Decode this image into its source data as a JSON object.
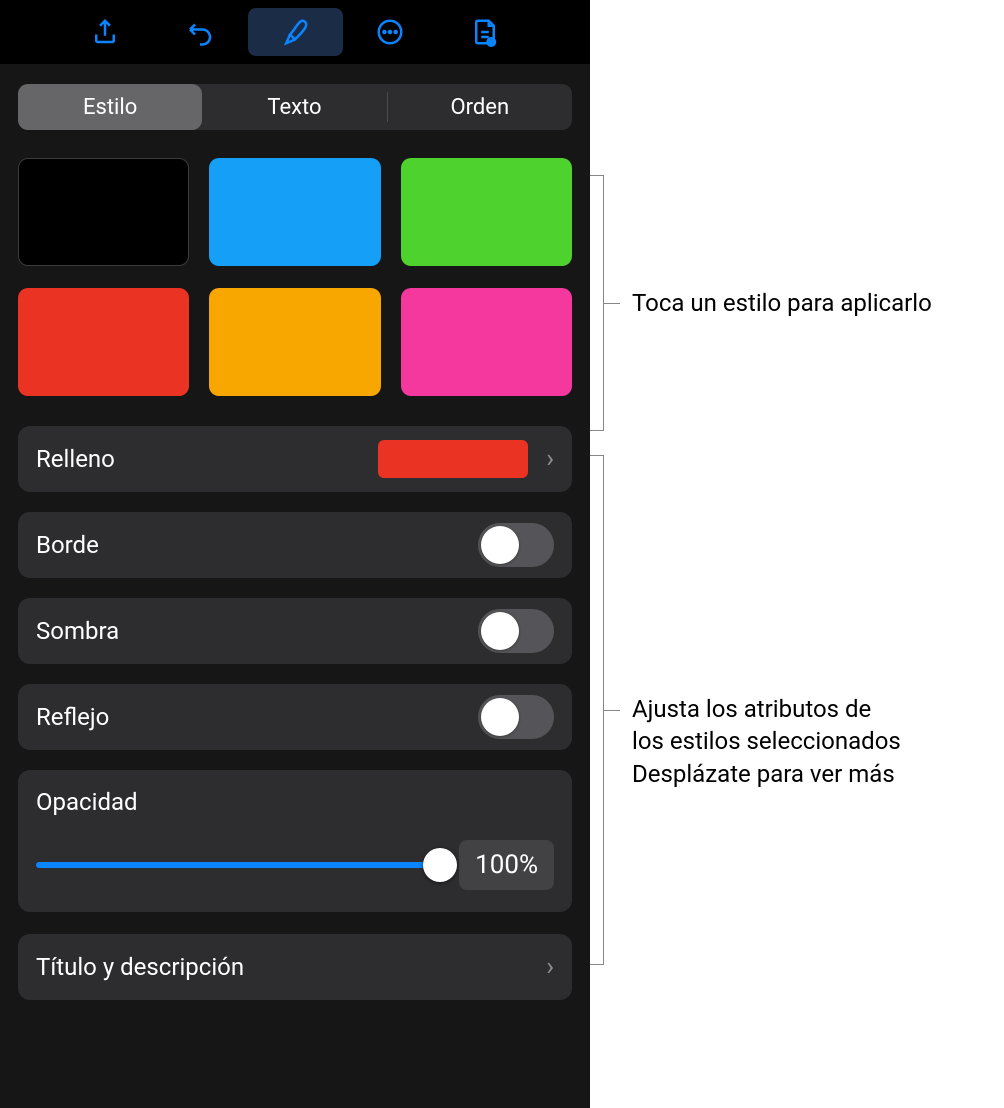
{
  "toolbar": {
    "icons": [
      "share-icon",
      "undo-icon",
      "brush-icon",
      "more-icon",
      "document-icon"
    ]
  },
  "segments": {
    "style": "Estilo",
    "text": "Texto",
    "order": "Orden"
  },
  "swatches": [
    {
      "name": "black",
      "color": "#000000"
    },
    {
      "name": "blue",
      "color": "#159ff6"
    },
    {
      "name": "green",
      "color": "#4dd22e"
    },
    {
      "name": "red",
      "color": "#ea3323"
    },
    {
      "name": "orange",
      "color": "#f7a700"
    },
    {
      "name": "magenta",
      "color": "#f4389e"
    }
  ],
  "rows": {
    "fill": {
      "label": "Relleno",
      "preview_color": "#ea3323"
    },
    "border": {
      "label": "Borde",
      "on": false
    },
    "shadow": {
      "label": "Sombra",
      "on": false
    },
    "reflection": {
      "label": "Reflejo",
      "on": false
    }
  },
  "opacity": {
    "label": "Opacidad",
    "value": "100%",
    "percent": 100
  },
  "title_desc": {
    "label": "Título y descripción"
  },
  "annotations": {
    "styles": "Toca un estilo para aplicarlo",
    "attributes": "Ajusta los atributos de los estilos seleccionados Desplázate para ver más"
  }
}
